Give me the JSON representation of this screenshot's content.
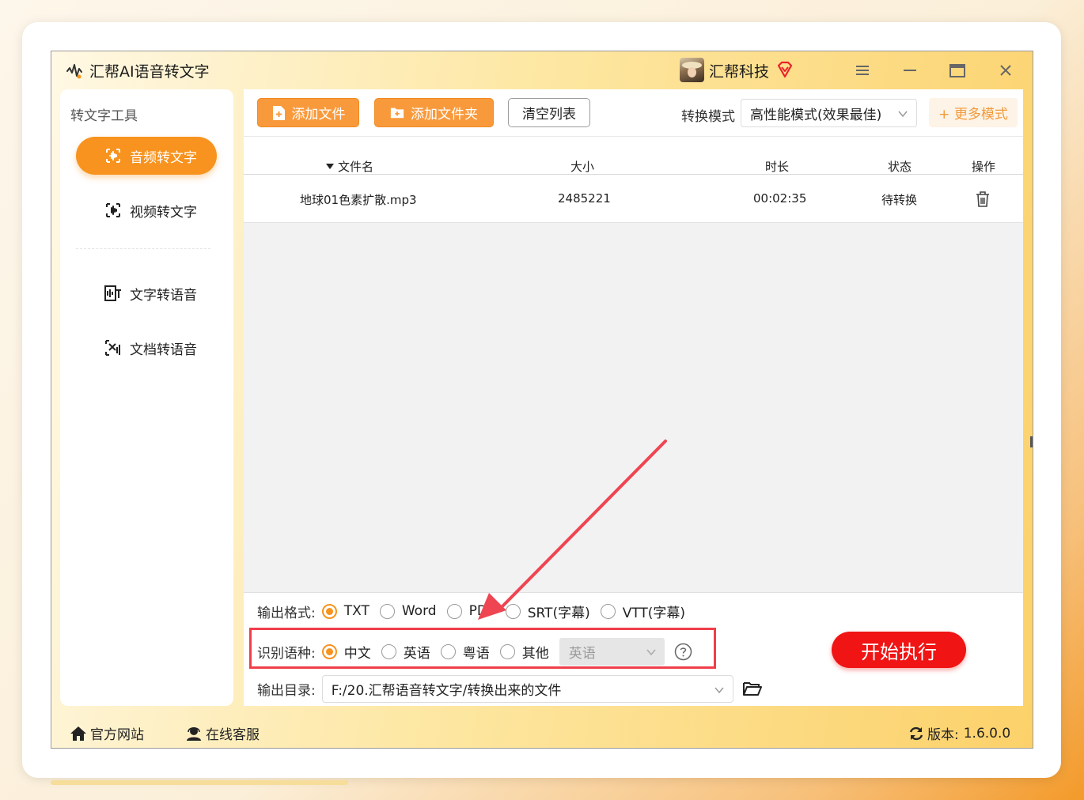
{
  "app": {
    "title": "汇帮AI语音转文字",
    "brand": "汇帮科技"
  },
  "sidebar": {
    "title": "转文字工具",
    "items": [
      {
        "label": "音频转文字",
        "icon": "audio-waveform-icon",
        "active": true
      },
      {
        "label": "视频转文字",
        "icon": "video-waveform-icon",
        "active": false
      },
      {
        "label": "文字转语音",
        "icon": "text-to-speech-icon",
        "active": false
      },
      {
        "label": "文档转语音",
        "icon": "document-to-speech-icon",
        "active": false
      }
    ]
  },
  "toolbar": {
    "add_file": "添加文件",
    "add_folder": "添加文件夹",
    "clear_list": "清空列表",
    "mode_label": "转换模式",
    "mode_value": "高性能模式(效果最佳)",
    "more_modes": "+ 更多模式"
  },
  "file_table": {
    "headers": {
      "name": "文件名",
      "size": "大小",
      "duration": "时长",
      "status": "状态",
      "action": "操作"
    },
    "rows": [
      {
        "name": "地球01色素扩散.mp3",
        "size": "2485221",
        "duration": "00:02:35",
        "status": "待转换"
      }
    ]
  },
  "options": {
    "format_label": "输出格式:",
    "formats": [
      "TXT",
      "Word",
      "PDF",
      "SRT(字幕)",
      "VTT(字幕)"
    ],
    "selected_format": "TXT",
    "language_label": "识别语种:",
    "languages": [
      "中文",
      "英语",
      "粤语",
      "其他"
    ],
    "selected_language": "中文",
    "other_language_value": "英语",
    "outdir_label": "输出目录:",
    "outdir_value": "F:/20.汇帮语音转文字/转换出来的文件",
    "start_button": "开始执行"
  },
  "footer": {
    "website": "官方网站",
    "support": "在线客服",
    "version_label": "版本:",
    "version_value": "1.6.0.0"
  },
  "colors": {
    "accent": "#f7931e",
    "start": "#f01414",
    "annotation": "#ef3f4a"
  }
}
